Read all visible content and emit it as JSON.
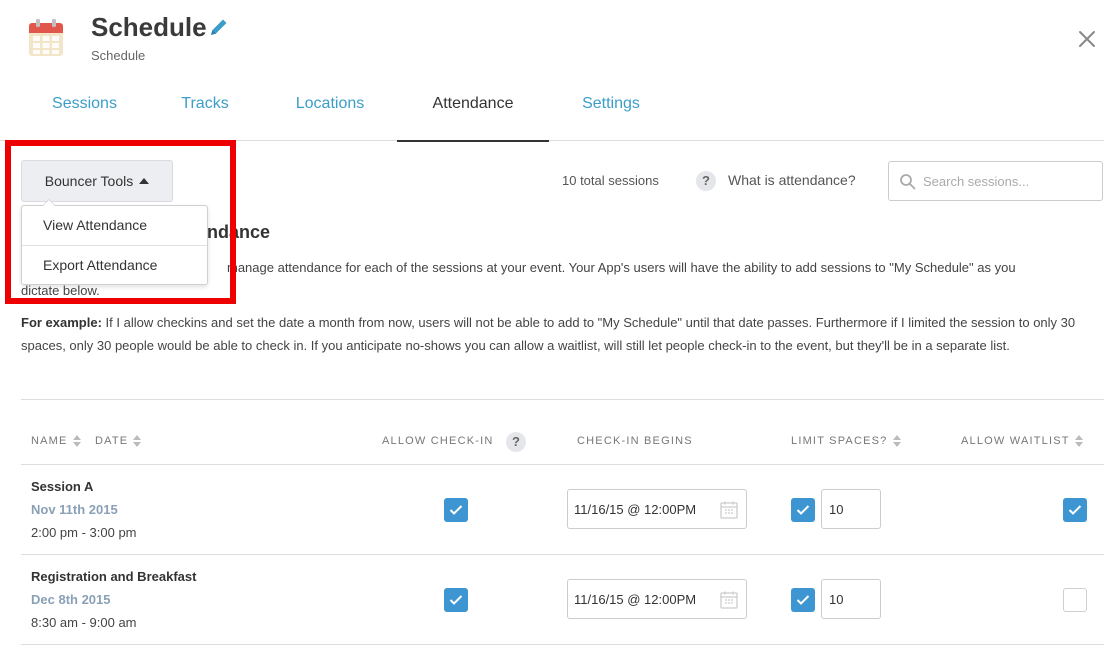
{
  "header": {
    "title": "Schedule",
    "subtitle": "Schedule",
    "app_icon": "calendar-icon",
    "edit_icon": "pencil-icon",
    "close_icon": "close-icon"
  },
  "tabs": [
    {
      "label": "Sessions",
      "active": false
    },
    {
      "label": "Tracks",
      "active": false
    },
    {
      "label": "Locations",
      "active": false
    },
    {
      "label": "Attendance",
      "active": true
    },
    {
      "label": "Settings",
      "active": false
    }
  ],
  "toolbar": {
    "bouncer_label": "Bouncer Tools",
    "menu": [
      "View Attendance",
      "Export Attendance"
    ],
    "total_sessions": "10 total sessions",
    "help_glyph": "?",
    "what_is_attendance": "What is attendance?",
    "search_placeholder": "Search sessions..."
  },
  "intro": {
    "heading_visible": "ndance",
    "description_visible": "manage attendance for each of the sessions at your event. Your App's users will have the ability to add sessions to \"My Schedule\" as you",
    "description_cont": "dictate below.",
    "example_label": "For example:",
    "example_text": "If I allow checkins and set the date a month from now, users will not be able to add to \"My Schedule\" until that date passes. Furthermore if I limited the session to only 30 spaces, only 30 people would be able to check in. If you anticipate no-shows you can allow a waitlist, will still let people check-in to the event, but they'll be in a separate list."
  },
  "table": {
    "columns": {
      "name": "NAME",
      "date": "DATE",
      "allow_checkin": "ALLOW CHECK-IN",
      "checkin_begins": "CHECK-IN BEGINS",
      "limit_spaces": "LIMIT SPACES?",
      "allow_waitlist": "ALLOW WAITLIST"
    },
    "rows": [
      {
        "name": "Session A",
        "date": "Nov 11th 2015",
        "time": "2:00 pm - 3:00 pm",
        "allow_checkin": true,
        "checkin_begins": "11/16/15 @ 12:00PM",
        "limit_spaces": true,
        "spaces": "10",
        "allow_waitlist": true
      },
      {
        "name": "Registration and Breakfast",
        "date": "Dec 8th 2015",
        "time": "8:30 am - 9:00 am",
        "allow_checkin": true,
        "checkin_begins": "11/16/15 @ 12:00PM",
        "limit_spaces": true,
        "spaces": "10",
        "allow_waitlist": false
      }
    ]
  },
  "colors": {
    "accent": "#3b9ec8",
    "checkbox": "#3d96d2",
    "highlight": "#ee0000"
  }
}
